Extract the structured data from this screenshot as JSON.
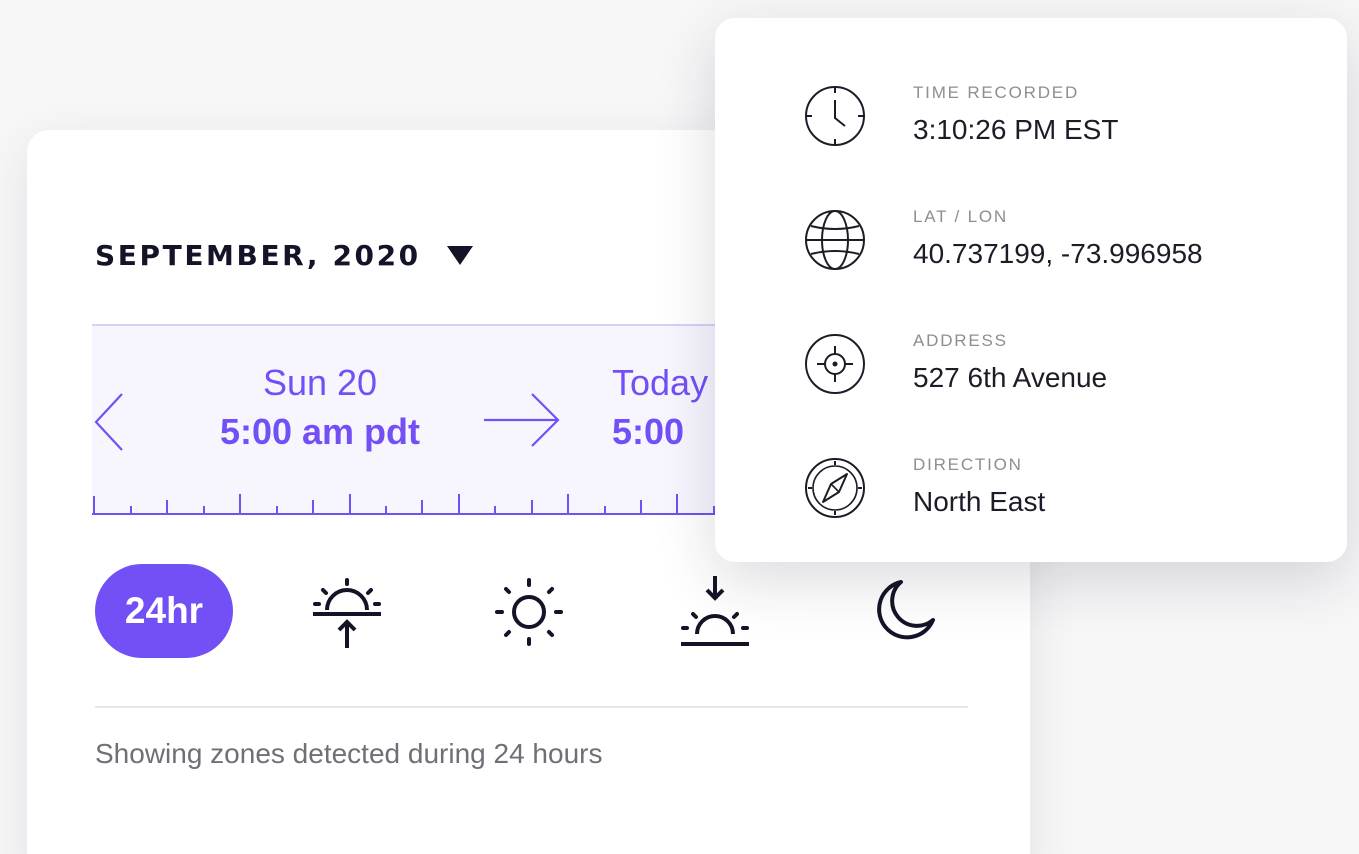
{
  "colors": {
    "accent": "#7350f5",
    "accent_soft": "#f7f6ff",
    "text_dark": "#141428",
    "text_muted": "#6f6f77"
  },
  "time_card": {
    "month_label": "SEPTEMBER, 2020",
    "month_dropdown_icon": "caret-down-icon",
    "range": {
      "from": {
        "day": "Sun 20",
        "time": "5:00 am pdt"
      },
      "to": {
        "day": "Today",
        "time": "5:00"
      }
    },
    "filters": [
      {
        "label": "24hr",
        "icon": "pill",
        "selected": true
      },
      {
        "icon": "sunrise-icon",
        "selected": false
      },
      {
        "icon": "sun-icon",
        "selected": false
      },
      {
        "icon": "sunset-icon",
        "selected": false
      },
      {
        "icon": "moon-icon",
        "selected": false
      }
    ],
    "status_text": "Showing zones detected during 24 hours"
  },
  "details": {
    "items": [
      {
        "label": "TIME RECORDED",
        "value": "3:10:26 PM EST",
        "icon": "clock-icon"
      },
      {
        "label": "LAT / LON",
        "value": "40.737199, -73.996958",
        "icon": "globe-icon"
      },
      {
        "label": "ADDRESS",
        "value": "527 6th Avenue",
        "icon": "crosshair-icon"
      },
      {
        "label": "DIRECTION",
        "value": "North East",
        "icon": "compass-icon"
      }
    ]
  }
}
